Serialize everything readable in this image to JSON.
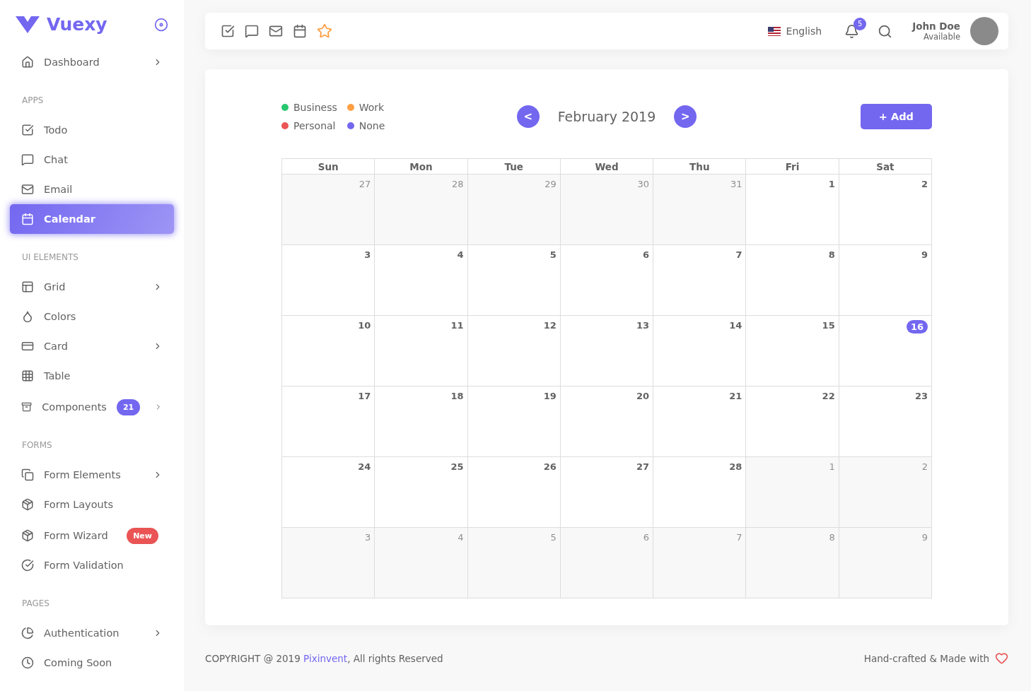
{
  "sidebar": {
    "brand": "Vuexy",
    "groups": [
      {
        "items": [
          {
            "label": "Dashboard",
            "selected": false,
            "expandable": true
          }
        ]
      },
      {
        "header": "APPS",
        "items": [
          {
            "label": "Todo",
            "selected": false,
            "expandable": false
          },
          {
            "label": "Chat",
            "selected": false,
            "expandable": false
          },
          {
            "label": "Email",
            "selected": false,
            "expandable": false
          },
          {
            "label": "Calendar",
            "selected": true,
            "expandable": false
          }
        ]
      },
      {
        "header": "UI ELEMENTS",
        "items": [
          {
            "label": "Grid",
            "selected": false,
            "expandable": true
          },
          {
            "label": "Colors",
            "selected": false,
            "expandable": false
          },
          {
            "label": "Card",
            "selected": false,
            "expandable": true
          },
          {
            "label": "Table",
            "selected": false,
            "expandable": false
          },
          {
            "label": "Components",
            "selected": false,
            "expandable": true,
            "badge": {
              "text": "21",
              "color": "#7367f0"
            }
          }
        ]
      },
      {
        "header": "FORMS",
        "items": [
          {
            "label": "Form Elements",
            "selected": false,
            "expandable": true
          },
          {
            "label": "Form Layouts",
            "selected": false,
            "expandable": false
          },
          {
            "label": "Form Wizard",
            "selected": false,
            "expandable": false,
            "badge": {
              "text": "New",
              "color": "#ea5455"
            }
          },
          {
            "label": "Form Validation",
            "selected": false,
            "expandable": false
          }
        ]
      },
      {
        "header": "PAGES",
        "items": [
          {
            "label": "Authentication",
            "selected": false,
            "expandable": true
          },
          {
            "label": "Coming Soon",
            "selected": false,
            "expandable": false
          }
        ]
      }
    ]
  },
  "topbar": {
    "language": "English",
    "notifications": "5",
    "user": {
      "name": "John Doe",
      "status": "Available"
    }
  },
  "calendar": {
    "legend": [
      {
        "label": "Business",
        "color": "#28c76f"
      },
      {
        "label": "Work",
        "color": "#ff9f43"
      },
      {
        "label": "Personal",
        "color": "#ea5455"
      },
      {
        "label": "None",
        "color": "#7367f0"
      }
    ],
    "prev": "<",
    "next": ">",
    "month": "February 2019",
    "add_button": "+ Add",
    "weekdays": [
      "Sun",
      "Mon",
      "Tue",
      "Wed",
      "Thu",
      "Fri",
      "Sat"
    ],
    "weeks": [
      [
        {
          "day": "27",
          "outside": true,
          "today": false
        },
        {
          "day": "28",
          "outside": true,
          "today": false
        },
        {
          "day": "29",
          "outside": true,
          "today": false
        },
        {
          "day": "30",
          "outside": true,
          "today": false
        },
        {
          "day": "31",
          "outside": true,
          "today": false
        },
        {
          "day": "1",
          "outside": false,
          "today": false
        },
        {
          "day": "2",
          "outside": false,
          "today": false
        }
      ],
      [
        {
          "day": "3",
          "outside": false,
          "today": false
        },
        {
          "day": "4",
          "outside": false,
          "today": false
        },
        {
          "day": "5",
          "outside": false,
          "today": false
        },
        {
          "day": "6",
          "outside": false,
          "today": false
        },
        {
          "day": "7",
          "outside": false,
          "today": false
        },
        {
          "day": "8",
          "outside": false,
          "today": false
        },
        {
          "day": "9",
          "outside": false,
          "today": false
        }
      ],
      [
        {
          "day": "10",
          "outside": false,
          "today": false
        },
        {
          "day": "11",
          "outside": false,
          "today": false
        },
        {
          "day": "12",
          "outside": false,
          "today": false
        },
        {
          "day": "13",
          "outside": false,
          "today": false
        },
        {
          "day": "14",
          "outside": false,
          "today": false
        },
        {
          "day": "15",
          "outside": false,
          "today": false
        },
        {
          "day": "16",
          "outside": false,
          "today": true
        }
      ],
      [
        {
          "day": "17",
          "outside": false,
          "today": false
        },
        {
          "day": "18",
          "outside": false,
          "today": false
        },
        {
          "day": "19",
          "outside": false,
          "today": false
        },
        {
          "day": "20",
          "outside": false,
          "today": false
        },
        {
          "day": "21",
          "outside": false,
          "today": false
        },
        {
          "day": "22",
          "outside": false,
          "today": false
        },
        {
          "day": "23",
          "outside": false,
          "today": false
        }
      ],
      [
        {
          "day": "24",
          "outside": false,
          "today": false
        },
        {
          "day": "25",
          "outside": false,
          "today": false
        },
        {
          "day": "26",
          "outside": false,
          "today": false
        },
        {
          "day": "27",
          "outside": false,
          "today": false
        },
        {
          "day": "28",
          "outside": false,
          "today": false
        },
        {
          "day": "1",
          "outside": true,
          "today": false
        },
        {
          "day": "2",
          "outside": true,
          "today": false
        }
      ],
      [
        {
          "day": "3",
          "outside": true,
          "today": false
        },
        {
          "day": "4",
          "outside": true,
          "today": false
        },
        {
          "day": "5",
          "outside": true,
          "today": false
        },
        {
          "day": "6",
          "outside": true,
          "today": false
        },
        {
          "day": "7",
          "outside": true,
          "today": false
        },
        {
          "day": "8",
          "outside": true,
          "today": false
        },
        {
          "day": "9",
          "outside": true,
          "today": false
        }
      ]
    ]
  },
  "footer": {
    "copyright": "COPYRIGHT @ 2019 ",
    "link": "Pixinvent",
    "rights": ", All rights Reserved",
    "credit": "Hand-crafted & Made with"
  }
}
